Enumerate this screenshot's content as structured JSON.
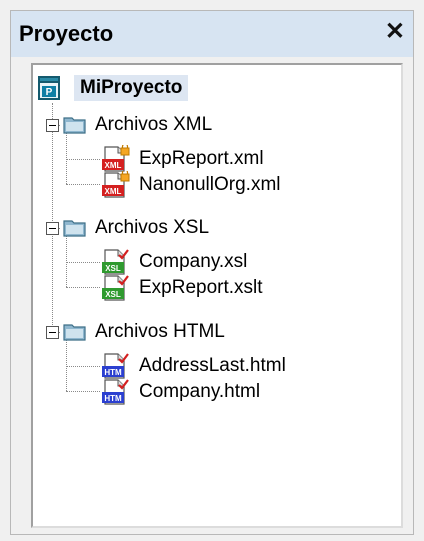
{
  "panel": {
    "title": "Proyecto",
    "close_glyph": "✕"
  },
  "tree": {
    "root": {
      "label": "MiProyecto",
      "icon": "project-icon"
    },
    "folders": [
      {
        "label": "Archivos XML",
        "icon": "folder-icon",
        "expanded": true,
        "files": [
          {
            "label": "ExpReport.xml",
            "icon": "xml-file-icon",
            "badge": "XML"
          },
          {
            "label": "NanonullOrg.xml",
            "icon": "xml-file-icon",
            "badge": "XML"
          }
        ]
      },
      {
        "label": "Archivos XSL",
        "icon": "folder-icon",
        "expanded": true,
        "files": [
          {
            "label": "Company.xsl",
            "icon": "xsl-file-icon",
            "badge": "XSL"
          },
          {
            "label": "ExpReport.xslt",
            "icon": "xsl-file-icon",
            "badge": "XSL"
          }
        ]
      },
      {
        "label": "Archivos HTML",
        "icon": "folder-icon",
        "expanded": true,
        "files": [
          {
            "label": "AddressLast.html",
            "icon": "html-file-icon",
            "badge": "HTM"
          },
          {
            "label": "Company.html",
            "icon": "html-file-icon",
            "badge": "HTM"
          }
        ]
      }
    ]
  },
  "colors": {
    "titlebar": "#d7e4f2",
    "selection": "#dde6f2",
    "xml_badge": "#d42020",
    "xsl_badge": "#2f9a2f",
    "html_badge": "#2b3fd0",
    "folder": "#8fb7cf"
  }
}
